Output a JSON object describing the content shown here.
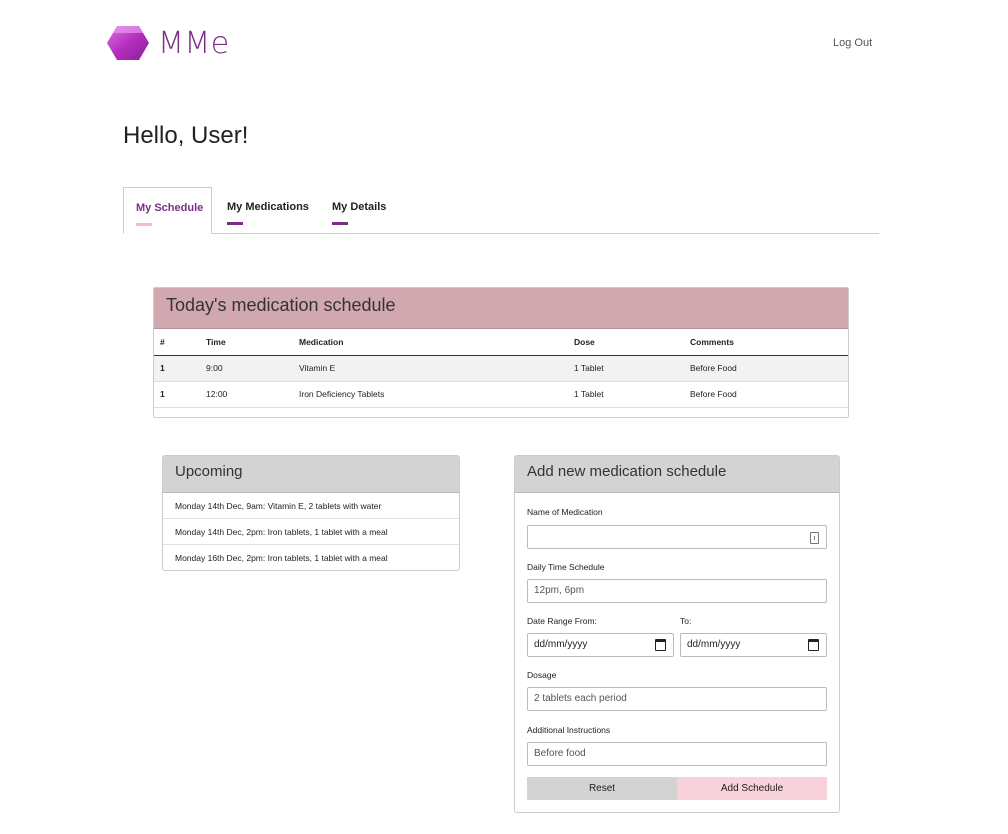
{
  "header": {
    "brand": "MMe",
    "logout_label": "Log Out"
  },
  "greeting": "Hello, User!",
  "tabs": [
    {
      "label": "My Schedule",
      "active": true
    },
    {
      "label": "My Medications",
      "active": false
    },
    {
      "label": "My Details",
      "active": false
    }
  ],
  "today": {
    "title": "Today's medication schedule",
    "columns": [
      "#",
      "Time",
      "Medication",
      "Dose",
      "Comments"
    ],
    "rows": [
      {
        "num": "1",
        "time": "9:00",
        "medication": "Vitamin E",
        "dose": "1 Tablet",
        "comments": "Before Food"
      },
      {
        "num": "1",
        "time": "12:00",
        "medication": "Iron Deficiency Tablets",
        "dose": "1 Tablet",
        "comments": "Before Food"
      }
    ]
  },
  "upcoming": {
    "title": "Upcoming",
    "items": [
      "Monday 14th Dec, 9am: Vitamin E, 2 tablets with water",
      "Monday 14th Dec, 2pm: Iron tablets, 1 tablet with a meal",
      "Monday 16th Dec, 2pm: Iron tablets, 1 tablet with a meal"
    ]
  },
  "form": {
    "title": "Add new medication schedule",
    "name_label": "Name of Medication",
    "name_value": "",
    "time_label": "Daily Time Schedule",
    "time_placeholder": "12pm, 6pm",
    "from_label": "Date Range From:",
    "to_label": "To:",
    "date_placeholder": "dd/mm/yyyy",
    "dosage_label": "Dosage",
    "dosage_placeholder": "2 tablets each period",
    "instructions_label": "Additional Instructions",
    "instructions_placeholder": "Before food",
    "reset_label": "Reset",
    "add_label": "Add Schedule"
  },
  "colors": {
    "brand": "#7a2f86",
    "today_header": "#d2a8b0",
    "add_button": "#f8d2da",
    "reset_button": "#d3d3d3"
  }
}
